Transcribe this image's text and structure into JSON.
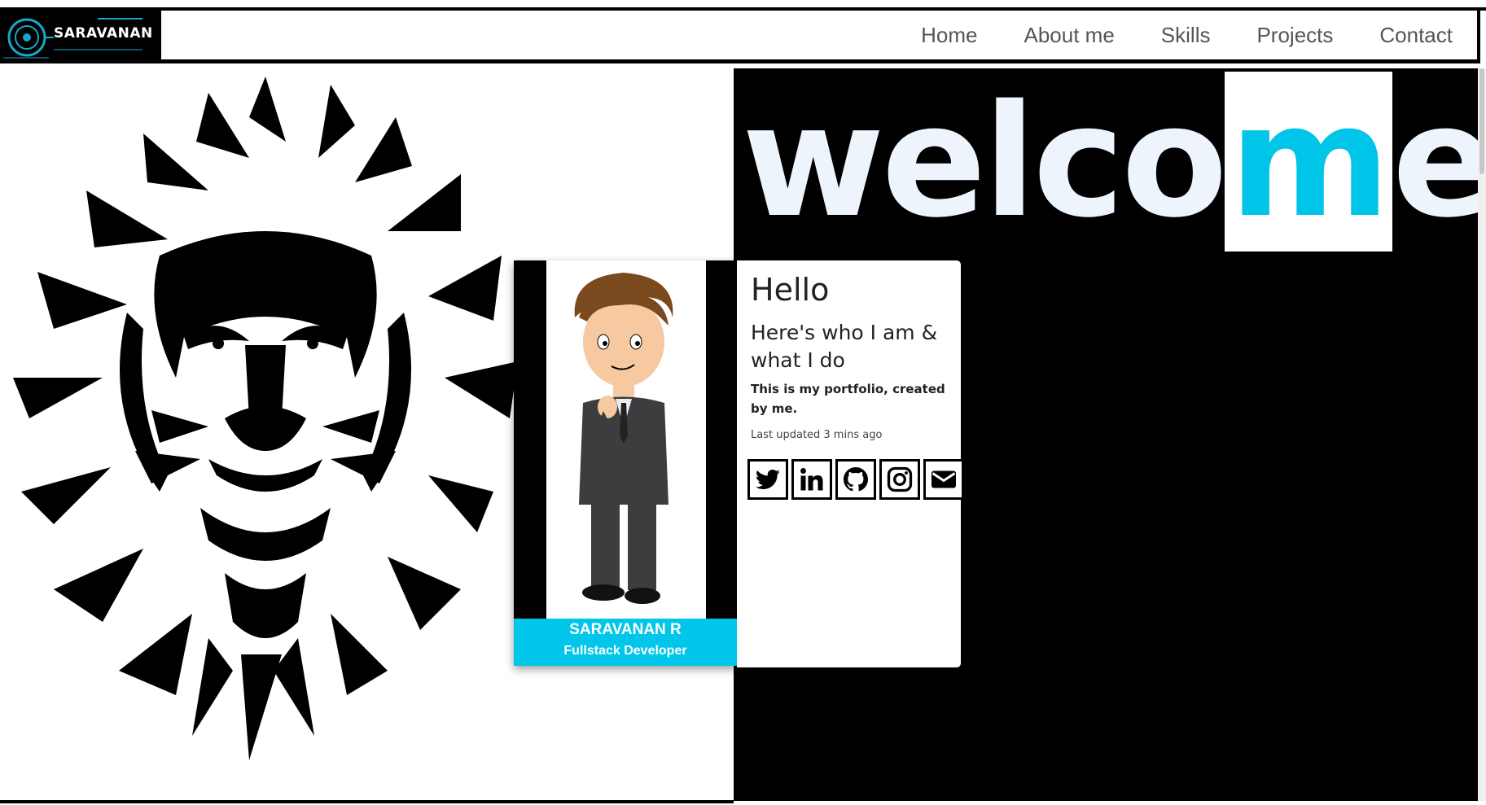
{
  "brand": {
    "name": "SARAVANAN"
  },
  "nav": {
    "links": [
      "Home",
      "About me",
      "Skills",
      "Projects",
      "Contact"
    ]
  },
  "hero": {
    "welcome_prefix": "welco",
    "welcome_highlight": "m",
    "welcome_suffix": "e",
    "accent_color": "#00c4e8"
  },
  "profile_card": {
    "name": "SARAVANAN R",
    "role": "Fullstack Developer"
  },
  "info_card": {
    "greeting": "Hello",
    "subtitle": "Here's who I am & what I do",
    "description": "This is my portfolio, created by me.",
    "updated": "Last updated 3 mins ago",
    "socials": [
      "twitter-icon",
      "linkedin-icon",
      "github-icon",
      "instagram-icon",
      "mail-icon"
    ]
  }
}
